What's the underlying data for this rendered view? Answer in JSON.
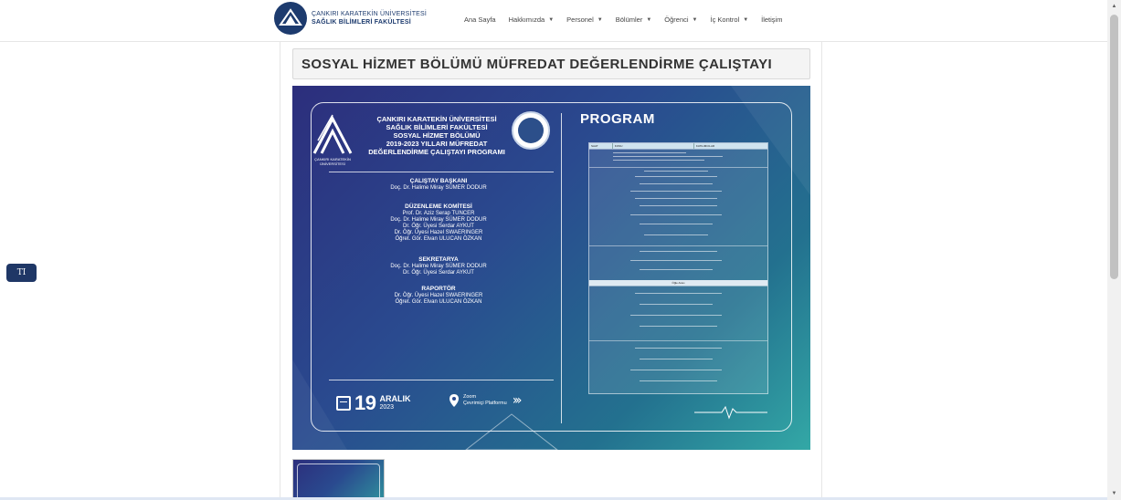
{
  "header": {
    "logo_line1": "ÇANKIRI KARATEKİN ÜNİVERSİTESİ",
    "logo_line2": "SAĞLIK BİLİMLERİ FAKÜLTESİ",
    "nav": [
      {
        "label": "Ana Sayfa",
        "dropdown": false
      },
      {
        "label": "Hakkımızda",
        "dropdown": true
      },
      {
        "label": "Personel",
        "dropdown": true
      },
      {
        "label": "Bölümler",
        "dropdown": true
      },
      {
        "label": "Öğrenci",
        "dropdown": true
      },
      {
        "label": "İç Kontrol",
        "dropdown": true
      },
      {
        "label": "İletişim",
        "dropdown": false
      }
    ]
  },
  "side_button": {
    "label": "TI"
  },
  "page": {
    "title": "SOSYAL HİZMET BÖLÜMÜ MÜFREDAT DEĞERLENDİRME ÇALIŞTAYI"
  },
  "poster": {
    "logo_caption_1": "ÇANKIRI KARATEKİN",
    "logo_caption_2": "ÜNİVERSİTESİ",
    "heading": [
      "ÇANKIRI KARATEKİN ÜNİVERSİTESİ",
      "SAĞLIK BİLİMLERİ FAKÜLTESİ",
      "SOSYAL HİZMET BÖLÜMÜ",
      "2019-2023 YILLARI MÜFREDAT",
      "DEĞERLENDİRME ÇALIŞTAYI PROGRAMI"
    ],
    "sections": [
      {
        "title": "ÇALIŞTAY BAŞKANI",
        "lines": [
          "Doç. Dr. Halime Miray SÜMER DODUR"
        ]
      },
      {
        "title": "DÜZENLEME KOMİTESİ",
        "lines": [
          "Prof. Dr. Aziz Serap TUNCER",
          "Doç. Dr. Halime Miray SÜMER DODUR",
          "Dr. Öğr. Üyesi Serdar AYKUT",
          "Dr. Öğr. Üyesi Hazel SWAERINGER",
          "Öğret. Gör. Elvan ULUCAN ÖZKAN"
        ]
      },
      {
        "title": "SEKRETARYA",
        "lines": [
          "Doç. Dr. Halime Miray SÜMER DODUR",
          "Dr. Öğr. Üyesi Serdar AYKUT"
        ]
      },
      {
        "title": "RAPORTÖR",
        "lines": [
          "Dr. Öğr. Üyesi Hazel SWAERINGER",
          "Öğret. Gör. Elvan ULUCAN ÖZKAN"
        ]
      }
    ],
    "date_day": "19",
    "date_month": "ARALIK",
    "date_year": "2023",
    "location_line1": "Zoom",
    "location_line2": "Çevrimiçi Platformu",
    "program_title": "PROGRAM",
    "program_headers": [
      "SAAT",
      "KONU",
      "KATILIMCILAR"
    ],
    "lunch_label": "Öğle Arası"
  },
  "colors": {
    "nav_blue": "#1d3b6e",
    "poster_dark": "#2c2e7c",
    "poster_teal": "#33a8a6"
  }
}
